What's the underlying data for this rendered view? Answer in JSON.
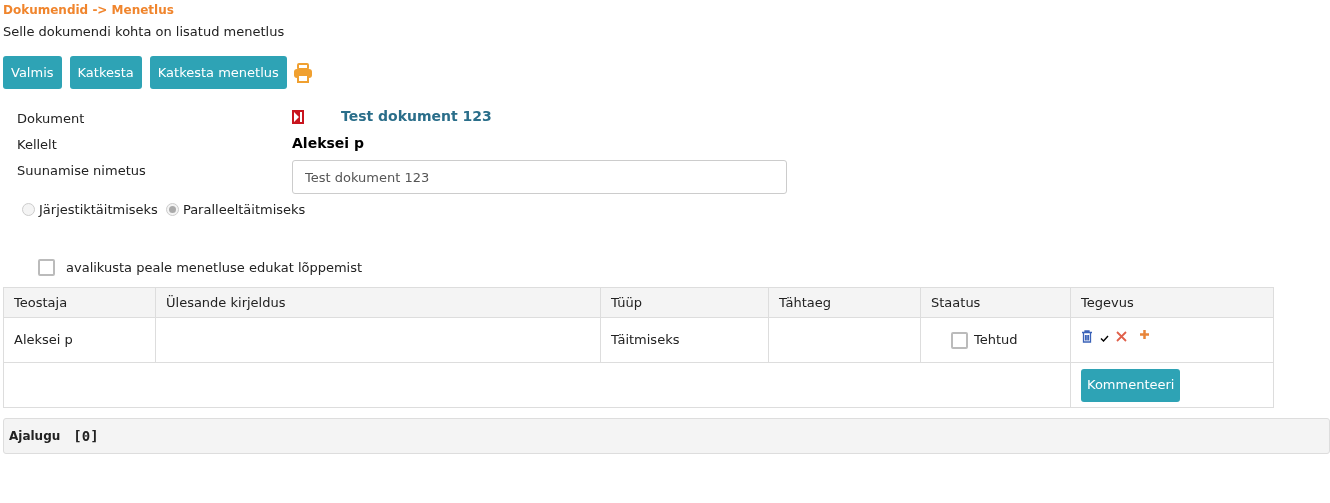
{
  "breadcrumb": "Dokumendid -> Menetlus",
  "notice": "Selle dokumendi kohta on lisatud menetlus",
  "buttons": [
    "Valmis",
    "Katkesta",
    "Katkesta menetlus"
  ],
  "form": {
    "document": {
      "label": "Dokument",
      "value": "Test dokument 123"
    },
    "from": {
      "label": "Kellelt",
      "value": "Aleksei p"
    },
    "routing_name": {
      "label": "Suunamise nimetus",
      "value": "Test dokument 123"
    }
  },
  "radios": [
    {
      "label": "Järjestiktäitmiseks",
      "selected": false,
      "disabled": true
    },
    {
      "label": "Paralleeltäitmiseks",
      "selected": true,
      "disabled": true
    }
  ],
  "publish_checkbox": {
    "label": "avalikusta peale menetluse edukat lõppemist",
    "checked": false
  },
  "table": {
    "columns": [
      "Teostaja",
      "Ülesande kirjeldus",
      "Tüüp",
      "Tähtaeg",
      "Staatus",
      "Tegevus"
    ],
    "rows": [
      {
        "performer": "Aleksei p",
        "type": "Täitmiseks",
        "status_label": "Tehtud",
        "done": false
      }
    ],
    "comment_button": "Kommenteeri"
  },
  "history": {
    "title": "Ajalugu",
    "count": "[0]"
  }
}
